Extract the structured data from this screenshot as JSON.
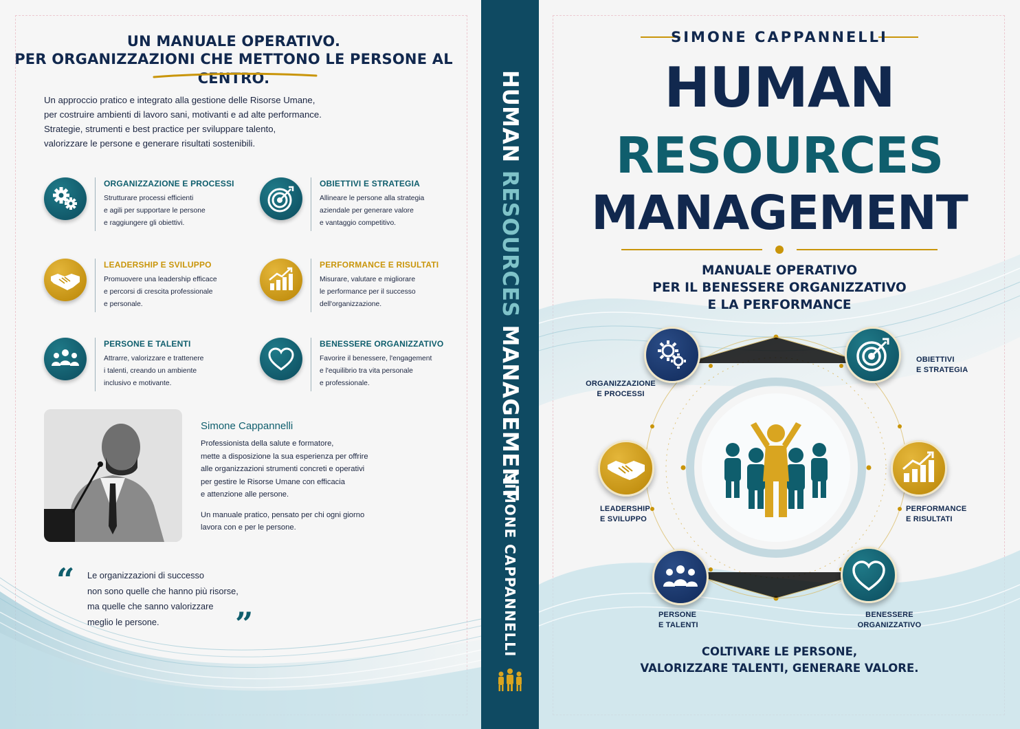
{
  "colors": {
    "navy": "#11284e",
    "teal": "#0f5e6d",
    "gold": "#c9950a",
    "spine": "#0f4a62"
  },
  "back_cover": {
    "headline_1": "UN MANUALE OPERATIVO.",
    "headline_2": "PER ORGANIZZAZIONI CHE METTONO LE PERSONE AL CENTRO.",
    "intro": [
      "Un approccio pratico e integrato alla gestione delle Risorse Umane,",
      "per costruire ambienti di lavoro sani, motivanti e ad alte performance.",
      "Strategie, strumenti e best practice per sviluppare talento,",
      "valorizzare le persone e generare risultati sostenibili."
    ],
    "features": [
      {
        "title": "ORGANIZZAZIONE E PROCESSI",
        "icon": "gears-icon",
        "lines": [
          "Strutturare processi efficienti",
          "e agili per supportare le persone",
          "e raggiungere gli obiettivi."
        ]
      },
      {
        "title": "OBIETTIVI E STRATEGIA",
        "icon": "target-icon",
        "lines": [
          "Allineare le persone alla strategia",
          "aziendale per generare valore",
          "e vantaggio competitivo."
        ]
      },
      {
        "title": "LEADERSHIP E SVILUPPO",
        "icon": "handshake-icon",
        "lines": [
          "Promuovere una leadership efficace",
          "e percorsi di crescita professionale",
          "e personale."
        ]
      },
      {
        "title": "PERFORMANCE E RISULTATI",
        "icon": "growth-chart-icon",
        "lines": [
          "Misurare, valutare e migliorare",
          "le performance per il successo",
          "dell'organizzazione."
        ]
      },
      {
        "title": "PERSONE E TALENTI",
        "icon": "people-group-icon",
        "lines": [
          "Attrarre, valorizzare e trattenere",
          "i talenti, creando un ambiente",
          "inclusivo e motivante."
        ]
      },
      {
        "title": "BENESSERE ORGANIZZATIVO",
        "icon": "heart-icon",
        "lines": [
          "Favorire il benessere, l'engagement",
          "e l'equilibrio tra vita personale",
          "e professionale."
        ]
      }
    ],
    "bio_name": "Simone Cappannelli",
    "bio_lines": [
      "Professionista della salute e formatore,",
      "mette a disposizione la sua esperienza per offrire",
      "alle organizzazioni strumenti concreti e operativi",
      "per gestire le Risorse Umane con efficacia",
      "e attenzione alle persone."
    ],
    "bio_lines_2": [
      "Un manuale pratico, pensato per chi ogni giorno",
      "lavora con e per le persone."
    ],
    "quote_lines": [
      "Le organizzazioni di successo",
      "non sono quelle che hanno più risorse,",
      "ma quelle che sanno valorizzare",
      "meglio le persone."
    ],
    "quote_open": "“",
    "quote_close": "”"
  },
  "spine": {
    "title_a": "HUMAN",
    "title_b": "RESOURCES",
    "title_c": "MANAGEMENT",
    "author": "SIMONE CAPPANNELLI"
  },
  "front_cover": {
    "author": "SIMONE CAPPANNELLI",
    "title_1": "HUMAN",
    "title_2": "RESOURCES",
    "title_3": "MANAGEMENT",
    "subtitle": [
      "MANUALE OPERATIVO",
      "PER IL BENESSERE ORGANIZZATIVO",
      "E LA PERFORMANCE"
    ],
    "labels": {
      "org": [
        "ORGANIZZAZIONE",
        "E PROCESSI"
      ],
      "obj": [
        "OBIETTIVI",
        "E STRATEGIA"
      ],
      "lead": [
        "LEADERSHIP",
        "E SVILUPPO"
      ],
      "perf": [
        "PERFORMANCE",
        "E RISULTATI"
      ],
      "people": [
        "PERSONE",
        "E TALENTI"
      ],
      "well": [
        "BENESSERE",
        "ORGANIZZATIVO"
      ]
    },
    "tagline": [
      "COLTIVARE LE PERSONE,",
      "VALORIZZARE TALENTI, GENERARE VALORE."
    ]
  }
}
